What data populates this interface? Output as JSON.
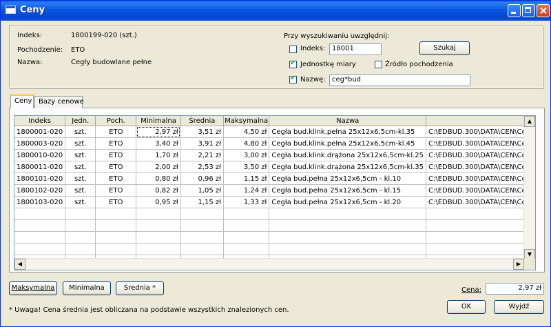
{
  "window": {
    "title": "Ceny"
  },
  "info": {
    "index_label": "Indeks:",
    "index_value": "1800199-020 (szt.)",
    "origin_label": "Pochodzenie:",
    "origin_value": "ETO",
    "name_label": "Nazwa:",
    "name_value": "Cegły budowlane pełne"
  },
  "search": {
    "header": "Przy wyszukiwaniu uwzględnij:",
    "index_checkbox": {
      "label": "Indeks:",
      "checked": false,
      "value": "18001"
    },
    "unit_checkbox": {
      "label": "Jednostkę miary",
      "checked": true
    },
    "source_checkbox": {
      "label": "Źródło pochodzenia",
      "checked": false
    },
    "name_checkbox": {
      "label": "Nazwę:",
      "checked": true,
      "value": "ceg*bud"
    },
    "search_button": "Szukaj"
  },
  "tabs": [
    {
      "label": "Ceny",
      "active": true
    },
    {
      "label": "Bazy cenowe",
      "active": false
    }
  ],
  "table": {
    "columns": [
      "Indeks",
      "Jedn.",
      "Poch.",
      "Minimalna",
      "Średnia",
      "Maksymalna",
      "Nazwa",
      ""
    ],
    "rows": [
      [
        "1800001-020",
        "szt.",
        "ETO",
        "2,97 zł",
        "3,51 zł",
        "4,50 zł",
        "Cegła bud.klink.pełna 25x12x6,5cm-kl.35",
        "C:\\EDBUD.300\\DATA\\CEN\\Ce"
      ],
      [
        "1800003-020",
        "szt.",
        "ETO",
        "3,40 zł",
        "3,91 zł",
        "4,80 zł",
        "Cegła bud.klink.pełna 25x12x6,5cm-kl.45",
        "C:\\EDBUD.300\\DATA\\CEN\\Ce"
      ],
      [
        "1800010-020",
        "szt.",
        "ETO",
        "1,70 zł",
        "2,21 zł",
        "3,00 zł",
        "Cegła bud.klink.drążona 25x12x6,5cm-kl.25",
        "C:\\EDBUD.300\\DATA\\CEN\\Ce"
      ],
      [
        "1800011-020",
        "szt.",
        "ETO",
        "2,00 zł",
        "2,53 zł",
        "3,50 zł",
        "Cegła bud.klink.drążona 25x12x6,5cm-kl.35",
        "C:\\EDBUD.300\\DATA\\CEN\\Ce"
      ],
      [
        "1800101-020",
        "szt.",
        "ETO",
        "0,80 zł",
        "0,96 zł",
        "1,15 zł",
        "Cegła bud.pełna 25x12x6,5cm - kl.10",
        "C:\\EDBUD.300\\DATA\\CEN\\Ce"
      ],
      [
        "1800102-020",
        "szt.",
        "ETO",
        "0,82 zł",
        "1,05 zł",
        "1,24 zł",
        "Cegła bud.pełna 25x12x6,5cm - kl.15",
        "C:\\EDBUD.300\\DATA\\CEN\\Ce"
      ],
      [
        "1800103-020",
        "szt.",
        "ETO",
        "0,95 zł",
        "1,15 zł",
        "1,33 zł",
        "Cegła bud.pełna 25x12x6,5cm - kl.20",
        "C:\\EDBUD.300\\DATA\\CEN\\Ce"
      ]
    ]
  },
  "buttons": {
    "max": "Maksymalna",
    "min": "Minimalna",
    "avg": "Średnia *",
    "ok": "OK",
    "exit": "Wyjdź"
  },
  "price": {
    "label": "Cena:",
    "value": "2,97 zł"
  },
  "note": "* Uwaga! Cena średnia jest obliczana na podstawie wszystkich znalezionych cen."
}
